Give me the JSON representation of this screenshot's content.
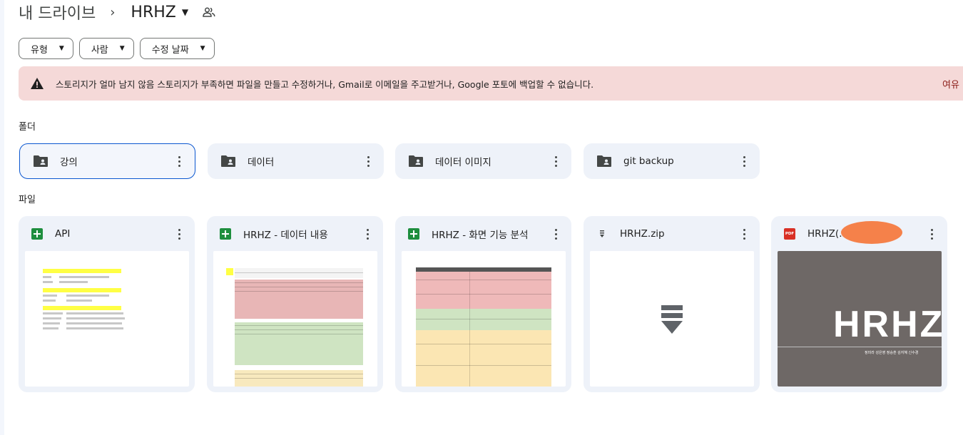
{
  "breadcrumb": {
    "root": "내 드라이브",
    "separator": "›",
    "current": "HRHZ"
  },
  "filters": [
    {
      "label": "유형"
    },
    {
      "label": "사람"
    },
    {
      "label": "수정 날짜"
    }
  ],
  "banner": {
    "message": "스토리지가 얼마 남지 않음 스토리지가 부족하면 파일을 만들고 수정하거나, Gmail로 이메일을 주고받거나, Google 포토에 백업할 수 없습니다.",
    "action": "여유 ",
    "color": "#f5d9d8"
  },
  "sections": {
    "folders": "폴더",
    "files": "파일"
  },
  "folders": [
    {
      "name": "강의",
      "icon": "shared-folder-icon",
      "selected": true
    },
    {
      "name": "데이터",
      "icon": "shared-folder-icon"
    },
    {
      "name": "데이터 이미지",
      "icon": "shared-folder-icon"
    },
    {
      "name": "git backup",
      "icon": "shared-folder-icon"
    }
  ],
  "files": [
    {
      "name": "API",
      "type": "sheet",
      "icon": "google-sheets-icon"
    },
    {
      "name": "HRHZ - 데이터 내용",
      "type": "sheet",
      "icon": "google-sheets-icon"
    },
    {
      "name": "HRHZ - 화면 기능 분석",
      "type": "sheet",
      "icon": "google-sheets-icon"
    },
    {
      "name": "HRHZ.zip",
      "type": "zip",
      "icon": "zip-icon"
    },
    {
      "name": "HRHZ(...",
      "type": "pdf",
      "icon": "pdf-icon",
      "thumb_title": "HRHZ",
      "thumb_caption": "정미라 성은영 정승훈 김지혜 신수경"
    }
  ],
  "colors": {
    "accent": "#0b57d0",
    "card_bg": "#eef2f9",
    "pdf_thumb_bg": "#6e6866",
    "banner_text_action": "#8c1d18"
  }
}
